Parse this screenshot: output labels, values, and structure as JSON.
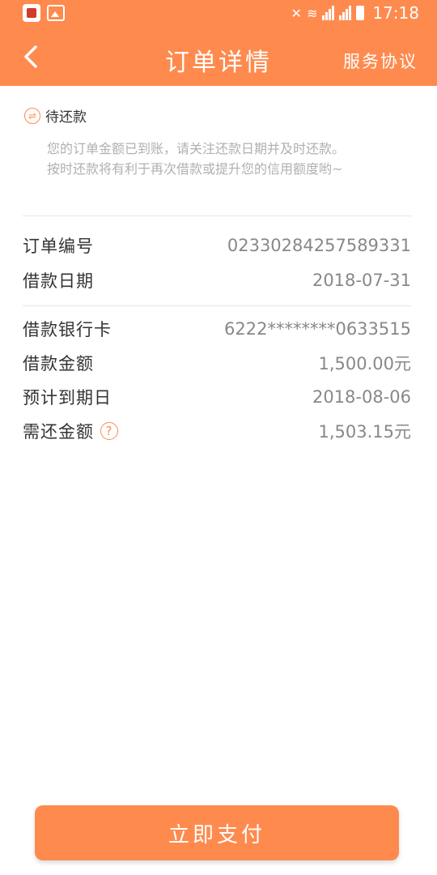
{
  "statusbar": {
    "time": "17:18"
  },
  "navbar": {
    "title": "订单详情",
    "agreement": "服务协议"
  },
  "order_status": {
    "title": "待还款",
    "description": "您的订单金额已到账，请关注还款日期并及时还款。按时还款将有利于再次借款或提升您的信用额度哟~"
  },
  "details": {
    "order_no_label": "订单编号",
    "order_no": "02330284257589331",
    "loan_date_label": "借款日期",
    "loan_date": "2018-07-31",
    "bank_card_label": "借款银行卡",
    "bank_card": "6222********0633515",
    "loan_amount_label": "借款金额",
    "loan_amount": "1,500.00元",
    "due_date_label": "预计到期日",
    "due_date": "2018-08-06",
    "repay_amount_label": "需还金额",
    "repay_amount": "1,503.15元"
  },
  "actions": {
    "pay_label": "立即支付"
  },
  "colors": {
    "accent": "#ff8a4e"
  }
}
